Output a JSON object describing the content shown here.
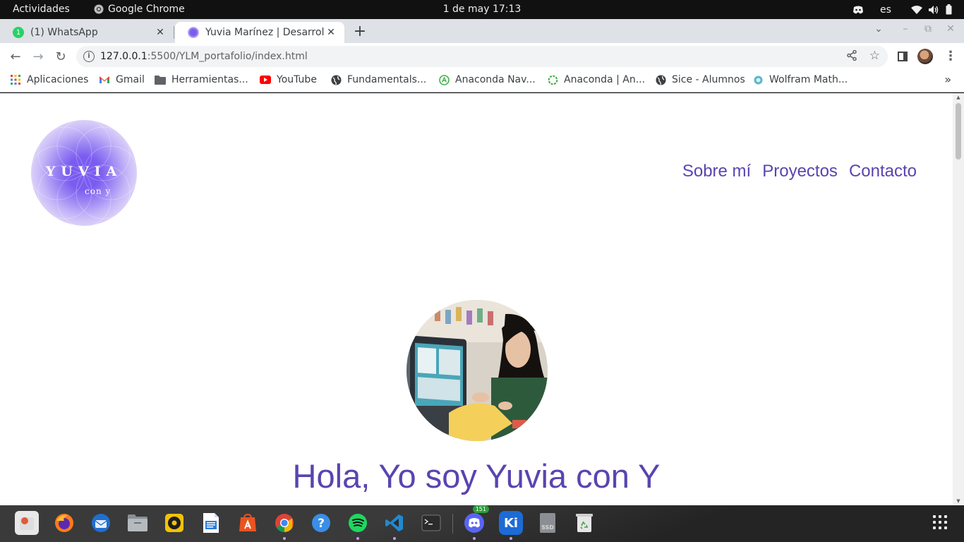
{
  "topbar": {
    "activities": "Actividades",
    "app_name": "Google Chrome",
    "clock": "1 de may  17:13",
    "language": "es"
  },
  "tabs": [
    {
      "title": "(1) WhatsApp",
      "active": false
    },
    {
      "title": "Yuvia Marínez | Desarrollo",
      "active": true
    }
  ],
  "toolbar": {
    "url_host": "127.0.0.1",
    "url_rest": ":5500/YLM_portafolio/index.html"
  },
  "bookmarks": [
    {
      "label": "Aplicaciones",
      "icon": "apps-grid-icon"
    },
    {
      "label": "Gmail",
      "icon": "gmail-icon"
    },
    {
      "label": "Herramientas...",
      "icon": "folder-icon"
    },
    {
      "label": "YouTube",
      "icon": "youtube-icon"
    },
    {
      "label": "Fundamentals...",
      "icon": "globe-icon"
    },
    {
      "label": "Anaconda Nav...",
      "icon": "anaconda-icon"
    },
    {
      "label": "Anaconda | An...",
      "icon": "anaconda-ring-icon"
    },
    {
      "label": "Sice - Alumnos",
      "icon": "globe-icon"
    },
    {
      "label": "Wolfram Math...",
      "icon": "wolfram-icon"
    }
  ],
  "page": {
    "logo_name": "YUVIA",
    "logo_sub": "con y",
    "nav": [
      "Sobre mí",
      "Proyectos",
      "Contacto"
    ],
    "greeting": "Hola, Yo soy Yuvia con Y"
  },
  "dock": {
    "discord_badge": "151",
    "apps": [
      "software-updater",
      "firefox",
      "thunderbird",
      "files",
      "rhythmbox",
      "libreoffice-writer",
      "app-center",
      "chrome",
      "help",
      "spotify",
      "vscode",
      "terminal",
      "discord",
      "kiwix",
      "ssd-drive",
      "trash"
    ]
  },
  "colors": {
    "accent": "#5a44b0",
    "logo_purple": "#7b5cf0"
  }
}
